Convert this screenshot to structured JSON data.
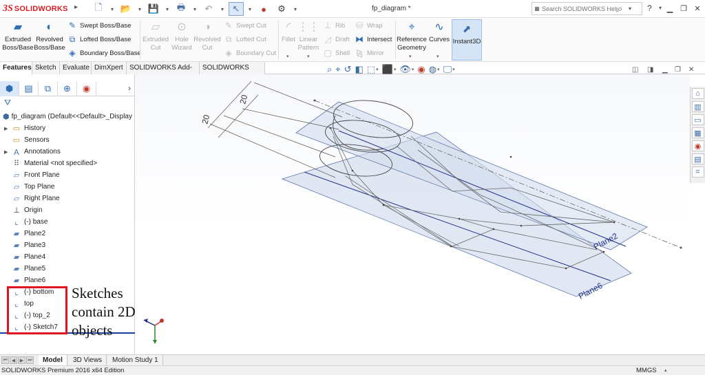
{
  "app": {
    "logo_ds": "3S",
    "logo_text": "SOLIDWORKS",
    "doc_title": "fp_diagram *",
    "search_placeholder": "Search SOLIDWORKS Help",
    "help_label": "?"
  },
  "ribbon": {
    "extruded_boss": "Extruded Boss/Base",
    "revolved_boss": "Revolved Boss/Base",
    "swept_boss": "Swept Boss/Base",
    "lofted_boss": "Lofted Boss/Base",
    "boundary_boss": "Boundary Boss/Base",
    "extruded_cut": "Extruded Cut",
    "hole_wizard": "Hole Wizard",
    "revolved_cut": "Revolved Cut",
    "swept_cut": "Swept Cut",
    "lofted_cut": "Lofted Cut",
    "boundary_cut": "Boundary Cut",
    "fillet": "Fillet",
    "linear_pattern": "Linear Pattern",
    "rib": "Rib",
    "draft": "Draft",
    "shell": "Shell",
    "wrap": "Wrap",
    "intersect": "Intersect",
    "mirror": "Mirror",
    "reference_geometry": "Reference Geometry",
    "curves": "Curves",
    "instant3d": "Instant3D"
  },
  "command_tabs": [
    "Features",
    "Sketch",
    "Evaluate",
    "DimXpert",
    "SOLIDWORKS Add-Ins",
    "SOLIDWORKS MBD"
  ],
  "tree": {
    "root": "fp_diagram  (Default<<Default>_Display",
    "items": [
      {
        "label": "History",
        "icon": "folder-icon",
        "expandable": true
      },
      {
        "label": "Sensors",
        "icon": "sensor-icon",
        "expandable": false
      },
      {
        "label": "Annotations",
        "icon": "annotation-icon",
        "expandable": true
      },
      {
        "label": "Material <not specified>",
        "icon": "material-icon",
        "expandable": false
      },
      {
        "label": "Front Plane",
        "icon": "plane-icon",
        "expandable": false
      },
      {
        "label": "Top Plane",
        "icon": "plane-icon",
        "expandable": false
      },
      {
        "label": "Right Plane",
        "icon": "plane-icon",
        "expandable": false
      },
      {
        "label": "Origin",
        "icon": "origin-icon",
        "expandable": false
      },
      {
        "label": "(-) base",
        "icon": "sketch-icon",
        "expandable": false
      },
      {
        "label": "Plane2",
        "icon": "plane-icon",
        "expandable": false
      },
      {
        "label": "Plane3",
        "icon": "plane-icon",
        "expandable": false
      },
      {
        "label": "Plane4",
        "icon": "plane-icon",
        "expandable": false
      },
      {
        "label": "Plane5",
        "icon": "plane-icon",
        "expandable": false
      },
      {
        "label": "Plane6",
        "icon": "plane-icon",
        "expandable": false
      },
      {
        "label": "(-) bottom",
        "icon": "sketch-icon",
        "expandable": false
      },
      {
        "label": "top",
        "icon": "sketch-icon",
        "expandable": false
      },
      {
        "label": "(-) top_2",
        "icon": "sketch-icon",
        "expandable": false
      },
      {
        "label": "(-) Sketch7",
        "icon": "sketch-icon",
        "expandable": false
      }
    ]
  },
  "annotation": {
    "line1": "Sketches",
    "line2": "contain 2D",
    "line3": "objects",
    "color": "#e0141e"
  },
  "viewport": {
    "dim_1": "20",
    "dim_2": "20",
    "plane_label_1": "Plane2",
    "plane_label_2": "Plane6"
  },
  "bottom_tabs": [
    "Model",
    "3D Views",
    "Motion Study 1"
  ],
  "status": {
    "edition": "SOLIDWORKS Premium 2016 x64 Edition",
    "units": "MMGS"
  }
}
